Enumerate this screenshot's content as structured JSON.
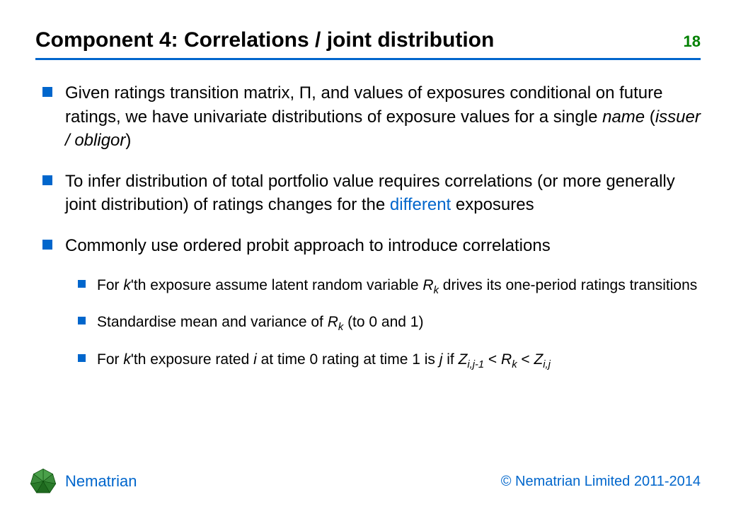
{
  "header": {
    "title": "Component 4: Correlations / joint distribution",
    "page_number": "18"
  },
  "bullets": [
    {
      "pre": "Given ratings transition matrix, ",
      "symbol": "Π",
      "mid": ", and values of exposures conditional on future ratings, we have univariate distributions of exposure values for a single ",
      "italic1": "name",
      "paren_open": " (",
      "italic2": "issuer / obligor",
      "paren_close": ")"
    },
    {
      "pre": "To infer distribution of total portfolio value requires correlations (or more generally joint distribution) of ratings changes for the ",
      "highlight": "different",
      "post": " exposures"
    },
    {
      "text": "Commonly use ordered probit approach to introduce correlations"
    }
  ],
  "sub_bullets": [
    {
      "p1": "For ",
      "i1": "k",
      "p2": "'th exposure assume latent random variable ",
      "i2": "R",
      "sub1": "k",
      "p3": " drives its one-period ratings transitions"
    },
    {
      "p1": "Standardise mean and variance of ",
      "i1": "R",
      "sub1": "k",
      "p2": " (to 0 and 1)"
    },
    {
      "p1": "For ",
      "i1": "k",
      "p2": "'th exposure rated ",
      "i2": "i",
      "p3": " at time 0 rating at time 1 is ",
      "i3": "j",
      "p4": " if ",
      "i4": "Z",
      "sub2": "i,j-1",
      "p5": " < ",
      "i5": "R",
      "sub3": "k",
      "p6": " < ",
      "i6": "Z",
      "sub4": "i,j"
    }
  ],
  "footer": {
    "brand": "Nematrian",
    "copyright": "© Nematrian Limited 2011-2014"
  }
}
